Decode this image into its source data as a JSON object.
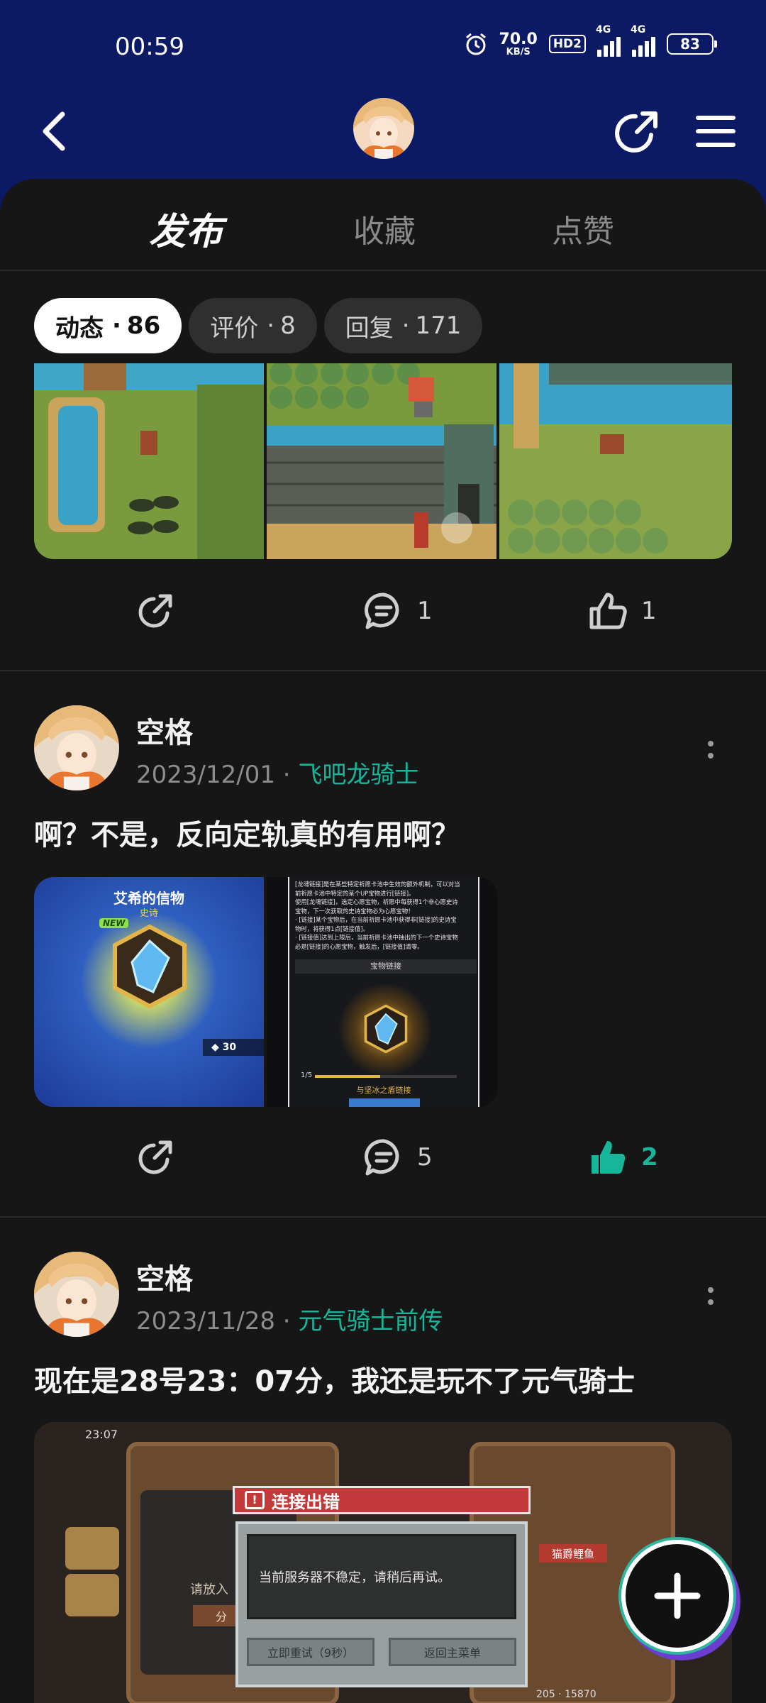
{
  "status_bar": {
    "time": "00:59",
    "net_speed_value": "70.0",
    "net_speed_unit": "KB/S",
    "hd_badge": "HD2",
    "signal1_label": "4G",
    "signal2_label": "4G",
    "battery": "83"
  },
  "tabs": {
    "publish": "发布",
    "collect": "收藏",
    "like": "点赞"
  },
  "filters": [
    {
      "label": "动态",
      "count": "86"
    },
    {
      "label": "评价",
      "count": "8"
    },
    {
      "label": "回复",
      "count": "171"
    }
  ],
  "post0": {
    "comments": "1",
    "likes": "1"
  },
  "post1": {
    "author": "空格",
    "date": "2023/12/01",
    "game": "飞吧龙骑士",
    "text": "啊？不是，反向定轨真的有用啊？",
    "img1_title": "艾希的信物",
    "img1_sub": "史诗",
    "img1_badge": "NEW",
    "img1_count": "30",
    "img2_lines": [
      "[龙魂链接]是在某些特定祈愿卡池中生效的额外机制，可以对当",
      "前祈愿卡池中特定的某个UP宝物进行[链接]。",
      "使用[龙魂链接]，选定心愿宝物，祈愿中每获得1个非心愿史诗",
      "宝物，下一次获取的史诗宝物必为心愿宝物！",
      "· [链接]某个宝物后，在当前祈愿卡池中获得非[链接]的史诗宝",
      "物时，将获得1点[链接值]。",
      "· [链接值]达到上限后，当前祈愿卡池中抽出的下一个史诗宝物",
      "必是[链接]的心愿宝物，触发后，[链接值]清零。"
    ],
    "img2_section": "宝物链接",
    "img2_progress": "1/5",
    "img2_caption": "与坚冰之盾链接",
    "comments": "5",
    "likes": "2"
  },
  "post2": {
    "author": "空格",
    "date": "2023/11/28",
    "game": "元气骑士前传",
    "text": "现在是28号23：07分，我还是玩不了元气骑士",
    "img_time": "23:07",
    "img_dialog_title": "连接出错",
    "img_dialog_msg": "当前服务器不稳定，请稍后再试。",
    "img_retry": "立即重试（9秒）",
    "img_back": "返回主菜单",
    "img_side_text": "请放入",
    "img_side_btn": "分",
    "img_npc_label": "猫爵鲤鱼",
    "img_bottom_nums": "205  ·  15870"
  },
  "colors": {
    "header_bg": "#0c1a66",
    "accent": "#17b59a",
    "page_bg": "#161616"
  },
  "icons": [
    "alarm-icon",
    "back-icon",
    "share-icon",
    "menu-icon",
    "comment-icon",
    "thumbs-up-icon",
    "more-icon",
    "plus-icon",
    "zoom-icon"
  ]
}
